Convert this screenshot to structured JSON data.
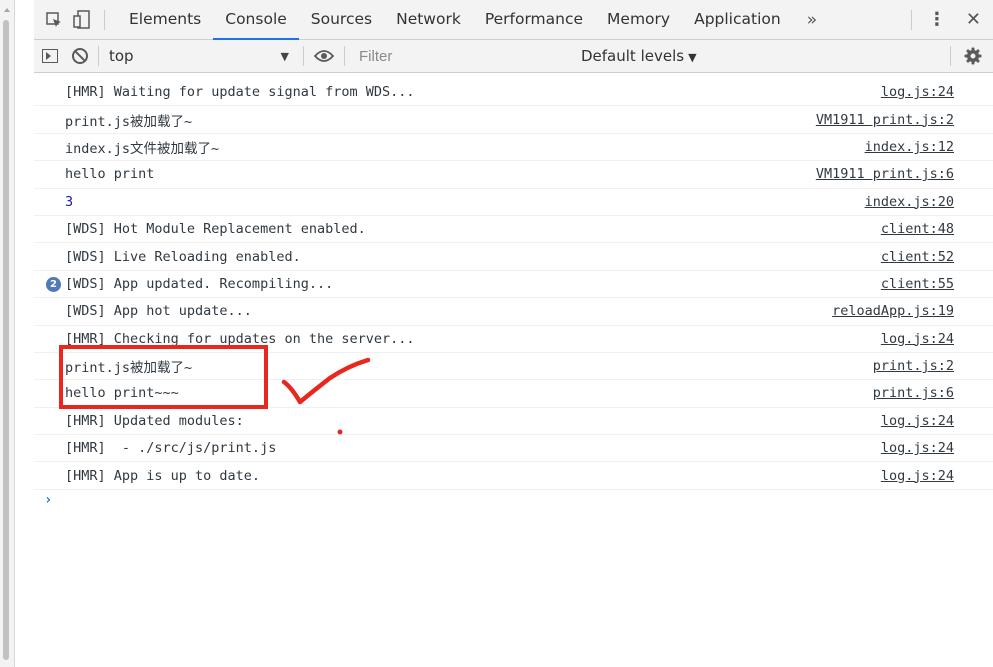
{
  "tabbar": {
    "inspect_icon": "inspect-element-icon",
    "device_icon": "device-toolbar-icon",
    "tabs": [
      {
        "label": "Elements"
      },
      {
        "label": "Console",
        "active": true
      },
      {
        "label": "Sources"
      },
      {
        "label": "Network"
      },
      {
        "label": "Performance"
      },
      {
        "label": "Memory"
      },
      {
        "label": "Application"
      }
    ],
    "more": "»",
    "menu": "⋮",
    "close": "✕"
  },
  "toolbar": {
    "context": "top",
    "filter_placeholder": "Filter",
    "levels": "Default levels"
  },
  "logs": [
    {
      "msg": "[HMR] Waiting for update signal from WDS...",
      "src": "log.js:24"
    },
    {
      "msg": "print.js被加载了~",
      "src": "VM1911 print.js:2"
    },
    {
      "msg": "index.js文件被加载了~",
      "src": "index.js:12"
    },
    {
      "msg": "hello print",
      "src": "VM1911 print.js:6"
    },
    {
      "msg": "3",
      "src": "index.js:20",
      "number": true
    },
    {
      "msg": "[WDS] Hot Module Replacement enabled.",
      "src": "client:48"
    },
    {
      "msg": "[WDS] Live Reloading enabled.",
      "src": "client:52"
    },
    {
      "msg": "[WDS] App updated. Recompiling...",
      "src": "client:55",
      "count": "2"
    },
    {
      "msg": "[WDS] App hot update...",
      "src": "reloadApp.js:19"
    },
    {
      "msg": "[HMR] Checking for updates on the server...",
      "src": "log.js:24"
    },
    {
      "msg": "print.js被加载了~",
      "src": "print.js:2"
    },
    {
      "msg": "hello print~~~",
      "src": "print.js:6"
    },
    {
      "msg": "[HMR] Updated modules:",
      "src": "log.js:24"
    },
    {
      "msg": "[HMR]  - ./src/js/print.js",
      "src": "log.js:24"
    },
    {
      "msg": "[HMR] App is up to date.",
      "src": "log.js:24"
    }
  ],
  "prompt": "›",
  "colors": {
    "accent": "#1a73e8",
    "annotation": "#e8281e",
    "count_badge": "#5079b7"
  }
}
